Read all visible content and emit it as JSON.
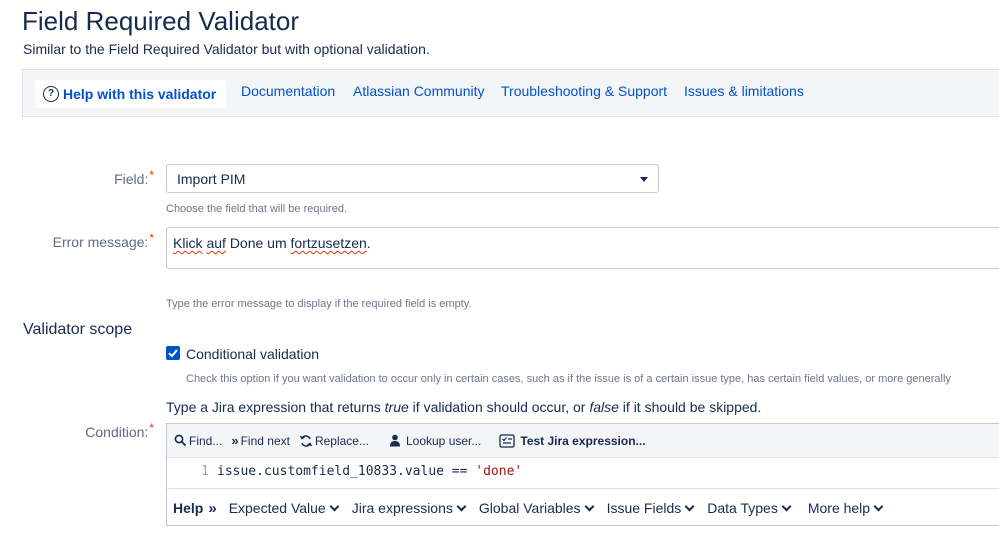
{
  "page": {
    "title": "Field Required Validator",
    "subtitle": "Similar to the Field Required Validator but with optional validation."
  },
  "help_bar": {
    "help_button": "Help with this validator",
    "links": [
      "Documentation",
      "Atlassian Community",
      "Troubleshooting & Support",
      "Issues & limitations"
    ]
  },
  "form": {
    "field": {
      "label": "Field:",
      "value": "Import PIM",
      "hint": "Choose the field that will be required."
    },
    "error_message": {
      "label": "Error message:",
      "value_parts": [
        "Klick",
        "auf",
        "Done um",
        "fortzusetzen",
        "."
      ],
      "hint": "Type the error message to display if the required field is empty."
    },
    "validator_scope": {
      "title": "Validator scope",
      "conditional_label": "Conditional validation",
      "conditional_checked": true,
      "conditional_hint": "Check this option if you want validation to occur only in certain cases, such as if the issue is of a certain issue type, has certain field values, or more generally"
    },
    "condition": {
      "label": "Condition:",
      "desc_parts": [
        "Type a Jira expression that returns ",
        "true",
        " if validation should occur, or ",
        "false",
        " if it should be skipped."
      ],
      "toolbar": {
        "find": "Find...",
        "find_next": "Find next",
        "replace": "Replace...",
        "lookup_user": "Lookup user...",
        "test_expression": "Test Jira expression..."
      },
      "code": {
        "line_number": "1",
        "prefix": "issue.customfield_10833.value == ",
        "string": "'done'"
      },
      "help_menu": {
        "help_label": "Help",
        "items": [
          "Expected Value",
          "Jira expressions",
          "Global Variables",
          "Issue Fields",
          "Data Types",
          "More help"
        ]
      }
    }
  },
  "colors": {
    "link": "#0052cc",
    "required": "#de350b",
    "checkbox": "#0052cc"
  }
}
